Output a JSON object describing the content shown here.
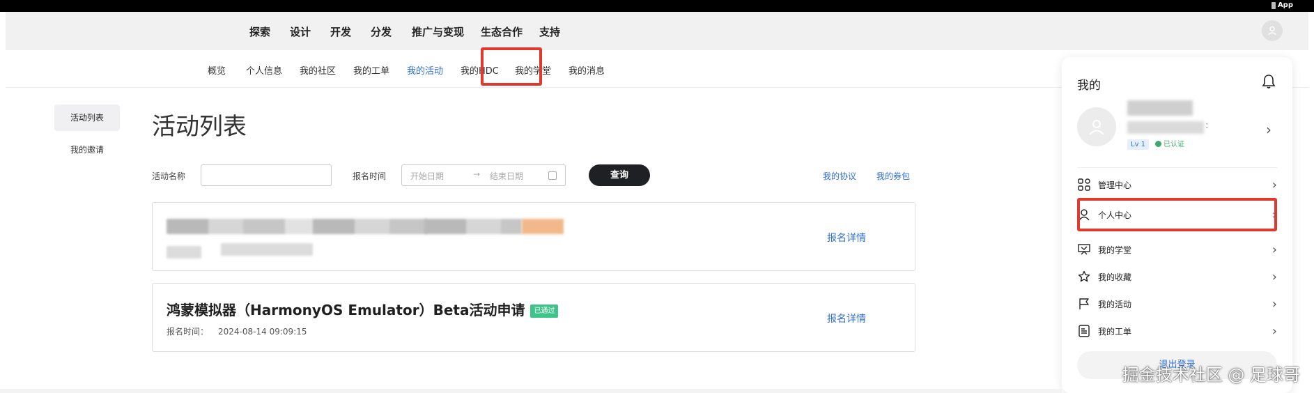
{
  "topbar": {
    "app_label": "App"
  },
  "main_nav": {
    "items": [
      "探索",
      "设计",
      "开发",
      "分发",
      "推广与变现",
      "生态合作",
      "支持"
    ]
  },
  "sub_nav": {
    "items": [
      "概览",
      "个人信息",
      "我的社区",
      "我的工单",
      "我的活动",
      "我的HDC",
      "我的学堂",
      "我的消息"
    ],
    "active": "我的活动"
  },
  "side_menu": {
    "items": [
      "活动列表",
      "我的邀请"
    ],
    "active": "活动列表"
  },
  "page": {
    "title": "活动列表"
  },
  "filters": {
    "name_label": "活动名称",
    "name_value": "",
    "time_label": "报名时间",
    "start_placeholder": "开始日期",
    "range_arrow": "→",
    "end_placeholder": "结束日期",
    "query_button": "查询",
    "link_agreement": "我的协议",
    "link_coupons": "我的券包"
  },
  "activities": [
    {
      "title": "",
      "badge": "",
      "meta_label": "",
      "meta_time": "",
      "detail_link": "报名详情",
      "redacted": true
    },
    {
      "title": "鸿蒙模拟器（HarmonyOS Emulator）Beta活动申请",
      "badge": "已通过",
      "meta_label": "报名时间：",
      "meta_time": "2024-08-14 09:09:15",
      "detail_link": "报名详情",
      "redacted": false
    }
  ],
  "panel": {
    "title": "我的",
    "level": "Lv 1",
    "verified": "已认证",
    "menu": [
      {
        "label": "管理中心",
        "icon": "grid-icon"
      },
      {
        "label": "个人中心",
        "icon": "person-icon"
      },
      {
        "label": "我的学堂",
        "icon": "classroom-icon"
      },
      {
        "label": "我的收藏",
        "icon": "star-icon"
      },
      {
        "label": "我的活动",
        "icon": "flag-icon"
      },
      {
        "label": "我的工单",
        "icon": "document-icon"
      }
    ],
    "logout": "退出登录"
  },
  "watermark": "掘金技术社区 @ 足球哥",
  "colors": {
    "accent": "#2f6fd8",
    "highlight_border": "#e03a2f",
    "badge_green": "#3ec38a",
    "query_button": "#1f2023"
  }
}
